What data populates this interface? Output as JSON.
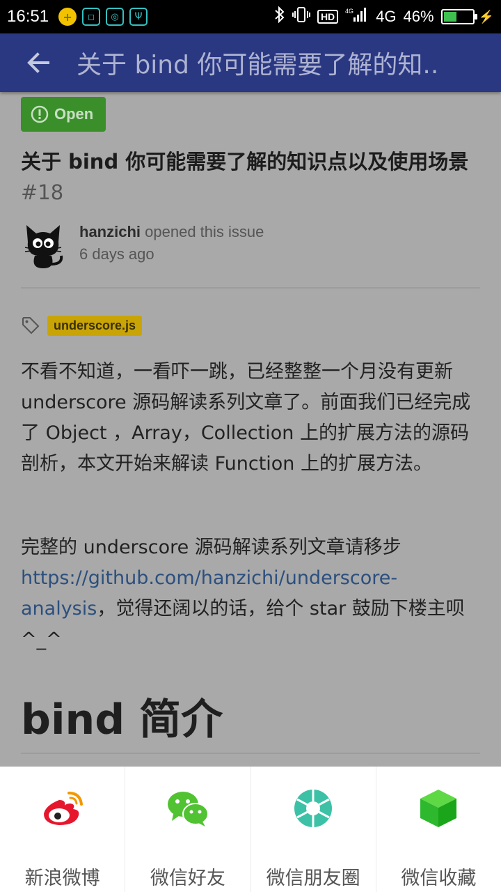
{
  "status_bar": {
    "time": "16:51",
    "network": "4G",
    "battery": "46%",
    "battery_level": 0.46,
    "hd": "HD"
  },
  "app_bar": {
    "title": "关于 bind 你可能需要了解的知.."
  },
  "issue": {
    "state": "Open",
    "title": "关于 bind 你可能需要了解的知识点以及使用场景",
    "number": "#18",
    "author": "hanzichi",
    "action": "opened this issue",
    "time": "6 days ago",
    "label": "underscore.js"
  },
  "body": {
    "p1": "不看不知道，一看吓一跳，已经整整一个月没有更新 underscore 源码解读系列文章了。前面我们已经完成了 Object ，Array，Collection 上的扩展方法的源码剖析，本文开始来解读 Function 上的扩展方法。",
    "p2_prefix": "完整的 underscore 源码解读系列文章请移步 ",
    "p2_link": "https://github.com/hanzichi/underscore-analysis",
    "p2_suffix": "，觉得还阔以的话，给个 star 鼓励下楼主呗 ^_^",
    "heading": "bind 简介"
  },
  "share_sheet": {
    "items": [
      {
        "label": "新浪微博",
        "icon": "weibo-icon"
      },
      {
        "label": "微信好友",
        "icon": "wechat-icon"
      },
      {
        "label": "微信朋友圈",
        "icon": "moments-icon"
      },
      {
        "label": "微信收藏",
        "icon": "favorites-icon"
      }
    ]
  },
  "colors": {
    "app_bar": "#2a3882",
    "open_badge": "#3a8f2a",
    "label_chip": "#c9a407",
    "link": "#2c4f7e"
  }
}
